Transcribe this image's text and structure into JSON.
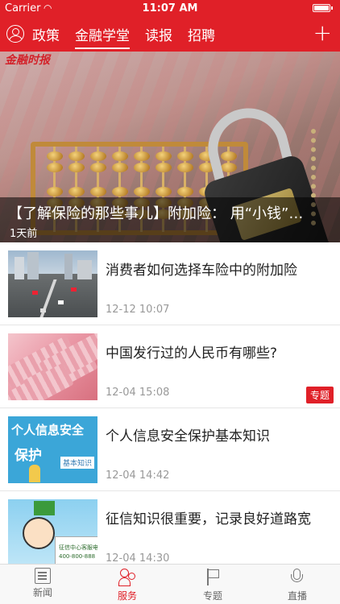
{
  "status_bar": {
    "carrier": "Carrier",
    "time": "11:07 AM"
  },
  "nav": {
    "tabs": [
      "政策",
      "金融学堂",
      "读报",
      "招聘"
    ],
    "active_tab_index": 1,
    "plus_label": "+"
  },
  "hero": {
    "logo_text": "金融时报",
    "title": "【了解保险的那些事儿】附加险： 用“小钱”…",
    "time": "1天前"
  },
  "news": [
    {
      "headline": "消费者如何选择车险中的附加险",
      "date": "12-12 10:07",
      "badge": ""
    },
    {
      "headline": "中国发行过的人民币有哪些?",
      "date": "12-04 15:08",
      "badge": "专题"
    },
    {
      "headline": "个人信息安全保护基本知识",
      "date": "12-04 14:42",
      "badge": ""
    },
    {
      "headline": "征信知识很重要，记录良好道路宽",
      "date": "12-04 14:30",
      "badge": ""
    }
  ],
  "thumbs": {
    "security_line1": "个人信息安全",
    "security_line2": "保护",
    "security_tag": "基本知识",
    "credit_card_line1": "征信中心客服电",
    "credit_card_line2": "400-800-888"
  },
  "tabbar": {
    "items": [
      "新闻",
      "服务",
      "专题",
      "直播"
    ],
    "active_index": 1
  },
  "colors": {
    "brand_red": "#e02028",
    "date_gray": "#999999",
    "divider": "#e6e6e6"
  },
  "icons": {
    "status": [
      "wifi-icon",
      "battery-icon"
    ],
    "nav": [
      "user-icon",
      "plus-icon"
    ],
    "tabbar": [
      "newspaper-icon",
      "people-icon",
      "flag-icon",
      "microphone-icon"
    ]
  }
}
